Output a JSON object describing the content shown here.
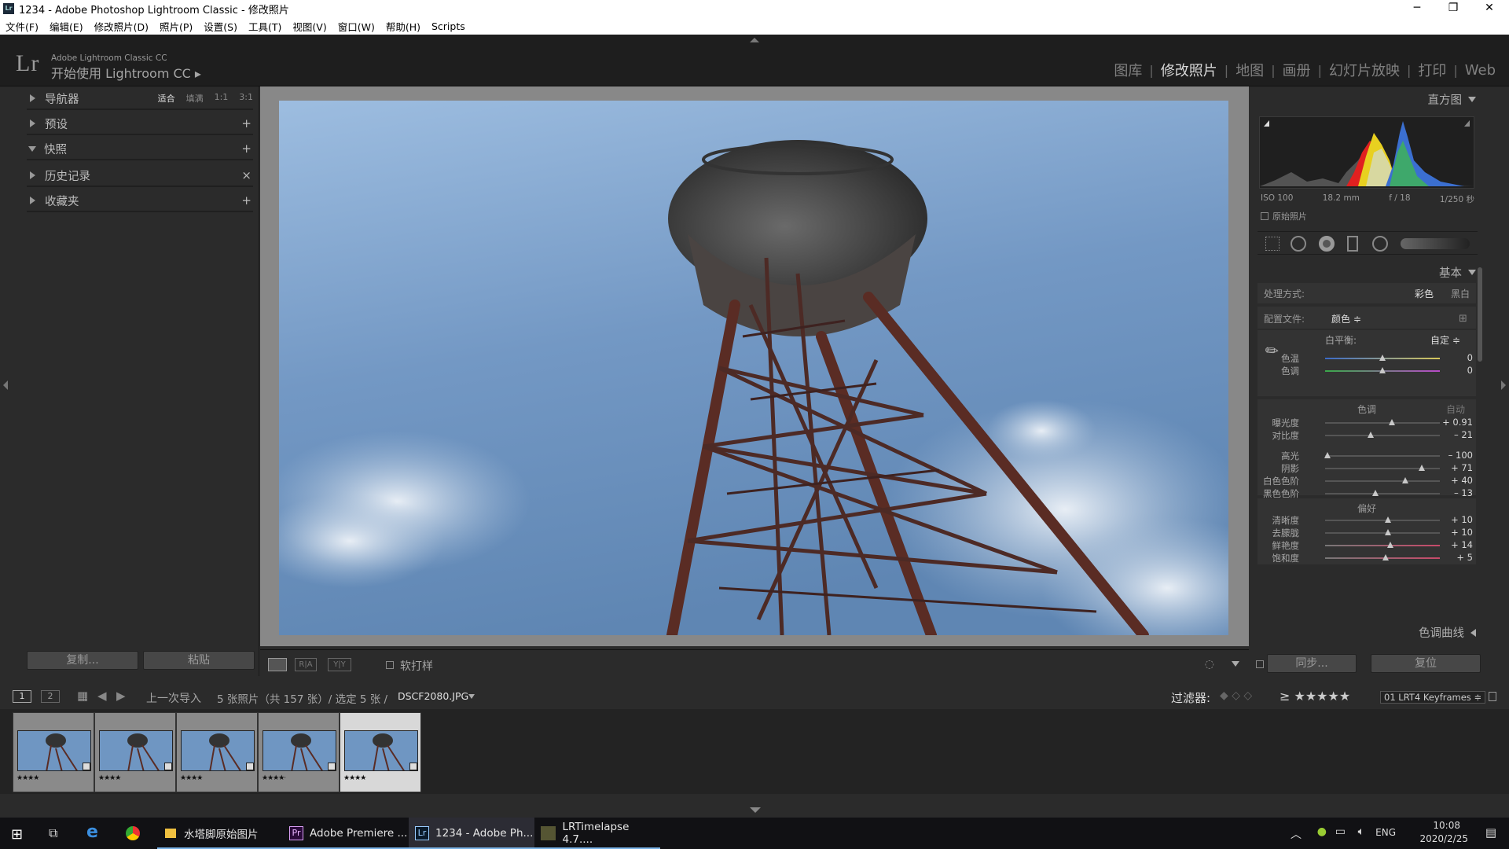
{
  "window": {
    "title": "1234 - Adobe Photoshop Lightroom Classic - 修改照片"
  },
  "menu": [
    "文件(F)",
    "编辑(E)",
    "修改照片(D)",
    "照片(P)",
    "设置(S)",
    "工具(T)",
    "视图(V)",
    "窗口(W)",
    "帮助(H)",
    "Scripts"
  ],
  "identity": {
    "logo": "Lr",
    "product": "Adobe Lightroom Classic CC",
    "tagline": "开始使用 Lightroom CC ▸"
  },
  "modules": [
    {
      "label": "图库",
      "active": false
    },
    {
      "label": "修改照片",
      "active": true
    },
    {
      "label": "地图",
      "active": false
    },
    {
      "label": "画册",
      "active": false
    },
    {
      "label": "幻灯片放映",
      "active": false
    },
    {
      "label": "打印",
      "active": false
    },
    {
      "label": "Web",
      "active": false
    }
  ],
  "left_panel": {
    "navigator": {
      "label": "导航器",
      "options": [
        "适合",
        "填满",
        "1:1",
        "3:1"
      ],
      "selected": "适合"
    },
    "sections": [
      {
        "label": "预设",
        "action": "+"
      },
      {
        "label": "快照",
        "action": "+"
      },
      {
        "label": "历史记录",
        "action": "×"
      },
      {
        "label": "收藏夹",
        "action": "+"
      }
    ],
    "copy_button": "复制...",
    "paste_button": "粘贴"
  },
  "toolbar": {
    "softproof": "软打样",
    "compare1": "R|A",
    "compare2": "Y|Y"
  },
  "right_panel": {
    "histogram_title": "直方图",
    "exif": [
      "ISO 100",
      "18.2 mm",
      "f / 18",
      "1/250 秒"
    ],
    "original_photo": "原始照片",
    "basic_title": "基本",
    "treatment_label": "处理方式:",
    "treatment_color": "彩色",
    "treatment_bw": "黑白",
    "profile_label": "配置文件:",
    "profile_value": "颜色 ≑",
    "wb_label": "白平衡:",
    "wb_value": "自定 ≑",
    "tone_label": "色调",
    "auto_label": "自动",
    "presence_label": "偏好",
    "tone_curve": "色调曲线",
    "sliders_wb": [
      {
        "label": "色温",
        "value": "0",
        "pos": 0.5
      },
      {
        "label": "色调",
        "value": "0",
        "pos": 0.5
      }
    ],
    "sliders_tone1": [
      {
        "label": "曝光度",
        "value": "+ 0.91",
        "pos": 0.58
      },
      {
        "label": "对比度",
        "value": "– 21",
        "pos": 0.4
      }
    ],
    "sliders_tone2": [
      {
        "label": "高光",
        "value": "– 100",
        "pos": 0.02
      },
      {
        "label": "阴影",
        "value": "+ 71",
        "pos": 0.84
      },
      {
        "label": "白色色阶",
        "value": "+ 40",
        "pos": 0.7
      },
      {
        "label": "黑色色阶",
        "value": "– 13",
        "pos": 0.44
      }
    ],
    "sliders_presence": [
      {
        "label": "清晰度",
        "value": "+ 10",
        "pos": 0.55
      },
      {
        "label": "去朦胧",
        "value": "+ 10",
        "pos": 0.55
      },
      {
        "label": "鲜艳度",
        "value": "+ 14",
        "pos": 0.57
      },
      {
        "label": "饱和度",
        "value": "+ 5",
        "pos": 0.53
      }
    ],
    "sync_button": "同步...",
    "reset_button": "复位"
  },
  "filmstrip": {
    "page1": "1",
    "page2": "2",
    "source": "上一次导入",
    "info": "5 张照片（共 157 张）/ 选定 5 张 /",
    "filename": "DSCF2080.JPG",
    "filter_label": "过滤器:",
    "filter_stars": "≥ ★★★★★",
    "preset": "01 LRT4 Keyframes ≑",
    "thumbs": [
      {
        "stars": "★★★★"
      },
      {
        "stars": "★★★★"
      },
      {
        "stars": "★★★★"
      },
      {
        "stars": "★★★★·"
      },
      {
        "stars": "★★★★"
      }
    ]
  },
  "taskbar": {
    "apps": [
      {
        "label": "水塔脚原始图片",
        "active": false
      },
      {
        "label": "Adobe Premiere ...",
        "active": false
      },
      {
        "label": "1234 - Adobe Ph...",
        "active": true
      },
      {
        "label": "LRTimelapse 4.7....",
        "active": false
      }
    ],
    "lang": "ENG",
    "time": "10:08",
    "date": "2020/2/25"
  },
  "colors": {
    "lr_panel": "#2b2b2b",
    "lr_background": "#1e1e1e",
    "accent_taskbar": "#7ab3e6"
  }
}
